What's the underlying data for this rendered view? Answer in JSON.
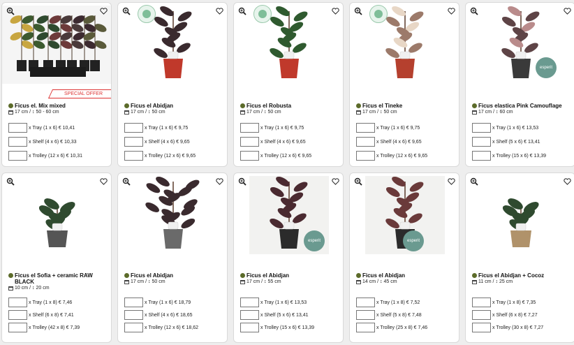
{
  "special_offer_label": "SPECIAL OFFER",
  "esperit_label": "esperit",
  "products": [
    {
      "name": "Ficus el. Mix mixed",
      "pot": "17 cm",
      "height": "50 - 60 cm",
      "options": [
        "x Tray (1 x 6) € 10,41",
        "x Shelf (4 x 6) € 10,33",
        "x Trolley (12 x 6) € 10,31"
      ]
    },
    {
      "name": "Ficus el Abidjan",
      "pot": "17 cm",
      "height": "50 cm",
      "options": [
        "x Tray (1 x 6) € 9,75",
        "x Shelf (4 x 6) € 9,65",
        "x Trolley (12 x 6) € 9,65"
      ]
    },
    {
      "name": "Ficus el Robusta",
      "pot": "17 cm",
      "height": "50 cm",
      "options": [
        "x Tray (1 x 6) € 9,75",
        "x Shelf (4 x 6) € 9,65",
        "x Trolley (12 x 6) € 9,65"
      ]
    },
    {
      "name": "Ficus el Tineke",
      "pot": "17 cm",
      "height": "50 cm",
      "options": [
        "x Tray (1 x 6) € 9,75",
        "x Shelf (4 x 6) € 9,65",
        "x Trolley (12 x 6) € 9,65"
      ]
    },
    {
      "name": "Ficus elastica Pink Camouflage",
      "pot": "17 cm",
      "height": "60 cm",
      "options": [
        "x Tray (1 x 6) € 13,53",
        "x Shelf (5 x 6) € 13,41",
        "x Trolley (15 x 6) € 13,39"
      ]
    },
    {
      "name": "Ficus el Sofia + ceramic RAW BLACK",
      "pot": "10 cm",
      "height": "20 cm",
      "options": [
        "x Tray (1 x 8) € 7,46",
        "x Shelf (6 x 8) € 7,41",
        "x Trolley (42 x 8) € 7,39"
      ]
    },
    {
      "name": "Ficus el Abidjan",
      "pot": "17 cm",
      "height": "50 cm",
      "options": [
        "x Tray (1 x 6) € 18,79",
        "x Shelf (4 x 6) € 18,65",
        "x Trolley (12 x 6) € 18,62"
      ]
    },
    {
      "name": "Ficus el Abidjan",
      "pot": "17 cm",
      "height": "55 cm",
      "options": [
        "x Tray (1 x 6) € 13,53",
        "x Shelf (5 x 6) € 13,41",
        "x Trolley (15 x 6) € 13,39"
      ]
    },
    {
      "name": "Ficus el Abidjan",
      "pot": "14 cm",
      "height": "45 cm",
      "options": [
        "x Tray (1 x 8) € 7,52",
        "x Shelf (5 x 8) € 7,48",
        "x Trolley (25 x 8) € 7,46"
      ]
    },
    {
      "name": "Ficus el Abidjan + Cocoz",
      "pot": "11 cm",
      "height": "25 cm",
      "options": [
        "x Tray (1 x 8) € 7,35",
        "x Shelf (6 x 8) € 7,27",
        "x Trolley (30 x 8) € 7,27"
      ]
    }
  ]
}
